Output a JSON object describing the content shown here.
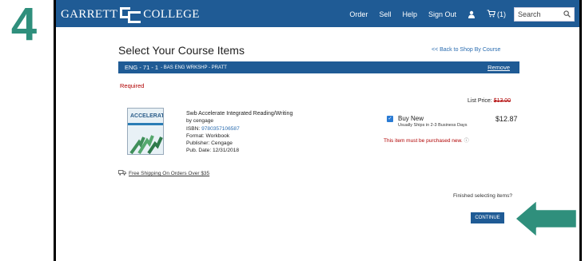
{
  "step": {
    "number": "4"
  },
  "header": {
    "logo_left": "GARRETT",
    "logo_right": "COLLEGE",
    "nav": [
      "Order",
      "Sell",
      "Help",
      "Sign Out"
    ],
    "user_icon": "user-icon",
    "cart_icon": "cart-icon",
    "cart_count": "(1)",
    "search_placeholder": "Search",
    "search_icon": "search-icon"
  },
  "page": {
    "title": "Select Your Course Items",
    "back_link": "<< Back to Shop By Course"
  },
  "course": {
    "code": "ENG - 71 - 1",
    "name": "- BAS ENG WRKSHP - PRATT",
    "remove": "Remove"
  },
  "item": {
    "required": "Required",
    "list_price_label": "List Price: ",
    "list_price_value": "$13.00",
    "cover_text": "ACCELERATE:",
    "title": "Swb Accelerate Integrated Reading/Writing",
    "by": "by cengage",
    "isbn_label": "ISBN: ",
    "isbn": "9780357106587",
    "format": "Format: Workbook",
    "publisher": "Publisher: Cengage",
    "pub_date": "Pub. Date: 12/31/2018",
    "buy_option": "Buy New",
    "ships": "Usually Ships in 2-3 Business Days",
    "price": "$12.87",
    "must_buy": "This item must be purchased new.",
    "shipping_note": "Free Shipping On Orders Over $35"
  },
  "footer": {
    "finished": "Finished selecting items?",
    "continue": "CONTINUE"
  },
  "colors": {
    "brand_blue": "#1f5b95",
    "required_red": "#b00000",
    "step_teal": "#2f8f7c",
    "link_blue": "#2a6cb0"
  }
}
